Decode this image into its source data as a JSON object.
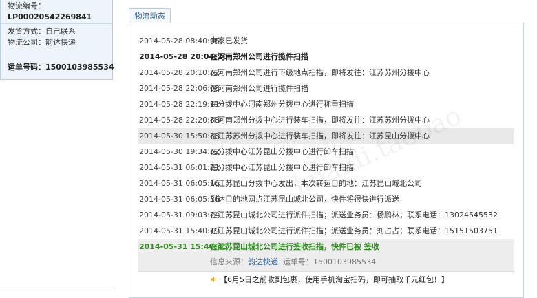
{
  "logistics_info": {
    "number_label": "物流编号：",
    "number_value": "LP00020542269841",
    "ship_method": "发货方式：自己联系",
    "company": "物流公司：韵达快递",
    "waybill": "运单号码：1500103985534"
  },
  "tab": {
    "label": "物流动态"
  },
  "timeline": [
    {
      "time": "2014-05-28 08:40:06",
      "desc": "卖家已发货"
    },
    {
      "time": "2014-05-28 20:04:26",
      "desc": "在河南郑州公司进行揽件扫描"
    },
    {
      "time": "2014-05-28 20:10:52",
      "desc": "在河南郑州公司进行下级地点扫描，即将发往：江苏苏州分拨中心"
    },
    {
      "time": "2014-05-28 22:06:08",
      "desc": "在河南郑州公司进行揽件扫描"
    },
    {
      "time": "2014-05-28 22:19:11",
      "desc": "在分拨中心河南郑州分拨中心进行称重扫描"
    },
    {
      "time": "2014-05-28 22:20:38",
      "desc": "在河南郑州分拨中心进行装车扫描，即将发往：江苏苏州分拨中心"
    },
    {
      "time": "2014-05-30 15:50:38",
      "desc": "在江苏苏州分拨中心进行装车扫描，即将发往：江苏昆山分拨中心"
    },
    {
      "time": "2014-05-30 19:34:52",
      "desc": "在分拨中心江苏昆山分拨中心进行卸车扫描"
    },
    {
      "time": "2014-05-31 06:01:21",
      "desc": "在分拨中心江苏昆山分拨中心进行卸车扫描"
    },
    {
      "time": "2014-05-31 06:05:16",
      "desc": "从江苏昆山分拨中心发出，本次转运目的地：江苏昆山城北公司"
    },
    {
      "time": "2014-05-31 06:05:36",
      "desc": "到达目的地网点江苏昆山城北公司，快件将很快进行派送"
    },
    {
      "time": "2014-05-31 09:03:24",
      "desc": "在江苏昆山城北公司进行派件扫描；派送业务员：杨鹏林；联系电话：13024545532"
    },
    {
      "time": "2014-05-31 15:40:19",
      "desc": "在江苏昆山城北公司进行派件扫描；派送业务员：刘占占；联系电话：15151503751"
    }
  ],
  "final_event": {
    "time": "2014-05-31 15:40:45",
    "desc": "在江苏昆山城北公司进行签收扫描，快件已被 签收"
  },
  "source": {
    "label": "信息来源：",
    "company": "韵达快递",
    "waybill": "运单号：1500103985534"
  },
  "promo": {
    "text": "【6月5日之前收到包裹，使用手机淘宝扫码，即可抽取千元红包！】"
  },
  "watermark": {
    "text": "kuaidi.taobao"
  },
  "colors": {
    "accent": "#2a5e99",
    "signed": "#2f8c1f",
    "panel_bg": "#eef4fb"
  }
}
